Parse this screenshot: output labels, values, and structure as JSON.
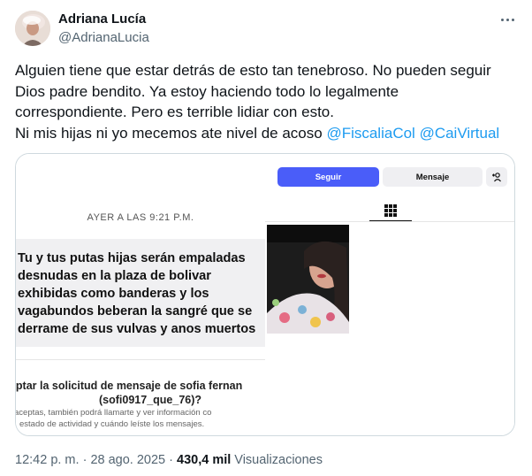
{
  "author": {
    "name": "Adriana Lucía",
    "handle": "@AdrianaLucia"
  },
  "tweet": {
    "lines": [
      "Alguien tiene que estar detrás de esto tan tenebroso. No pueden seguir",
      "Dios padre bendito. Ya estoy haciendo todo lo legalmente",
      "correspondiente. Pero es terrible lidiar con esto."
    ],
    "last_line_text": "Ni mis hijas ni yo mecemos ate nivel de acoso",
    "mentions": [
      "@FiscaliaCol",
      "@CaiVirtual"
    ]
  },
  "screenshot": {
    "timestamp": "AYER A LAS 9:21 P.M.",
    "message_lines": [
      "Tu y tus putas hijas serán empaladas",
      "desnudas en la plaza de bolivar",
      "exhibidas como banderas y los",
      "vagabundos beberan la sangré que se",
      "derrame de sus vulvas y anos muertos"
    ],
    "request_title_line1": "ceptar la solicitud de mensaje de sofia fernan",
    "request_title_line2": "(sofi0917_que_76)?",
    "request_sub_line1": "aceptas, también podrá llamarte y ver información co",
    "request_sub_line2": "estado de actividad y cuándo leíste los mensajes.",
    "follow_label": "Seguir",
    "message_label": "Mensaje",
    "accent_color": "#4a5df9"
  },
  "footer": {
    "time": "12:42 p. m.",
    "separator": " · ",
    "date": "28 ago. 2025",
    "views_count": "430,4 mil",
    "views_label": "Visualizaciones"
  },
  "icons": [
    "avatar",
    "more-icon",
    "grid-icon",
    "add-user-icon"
  ]
}
